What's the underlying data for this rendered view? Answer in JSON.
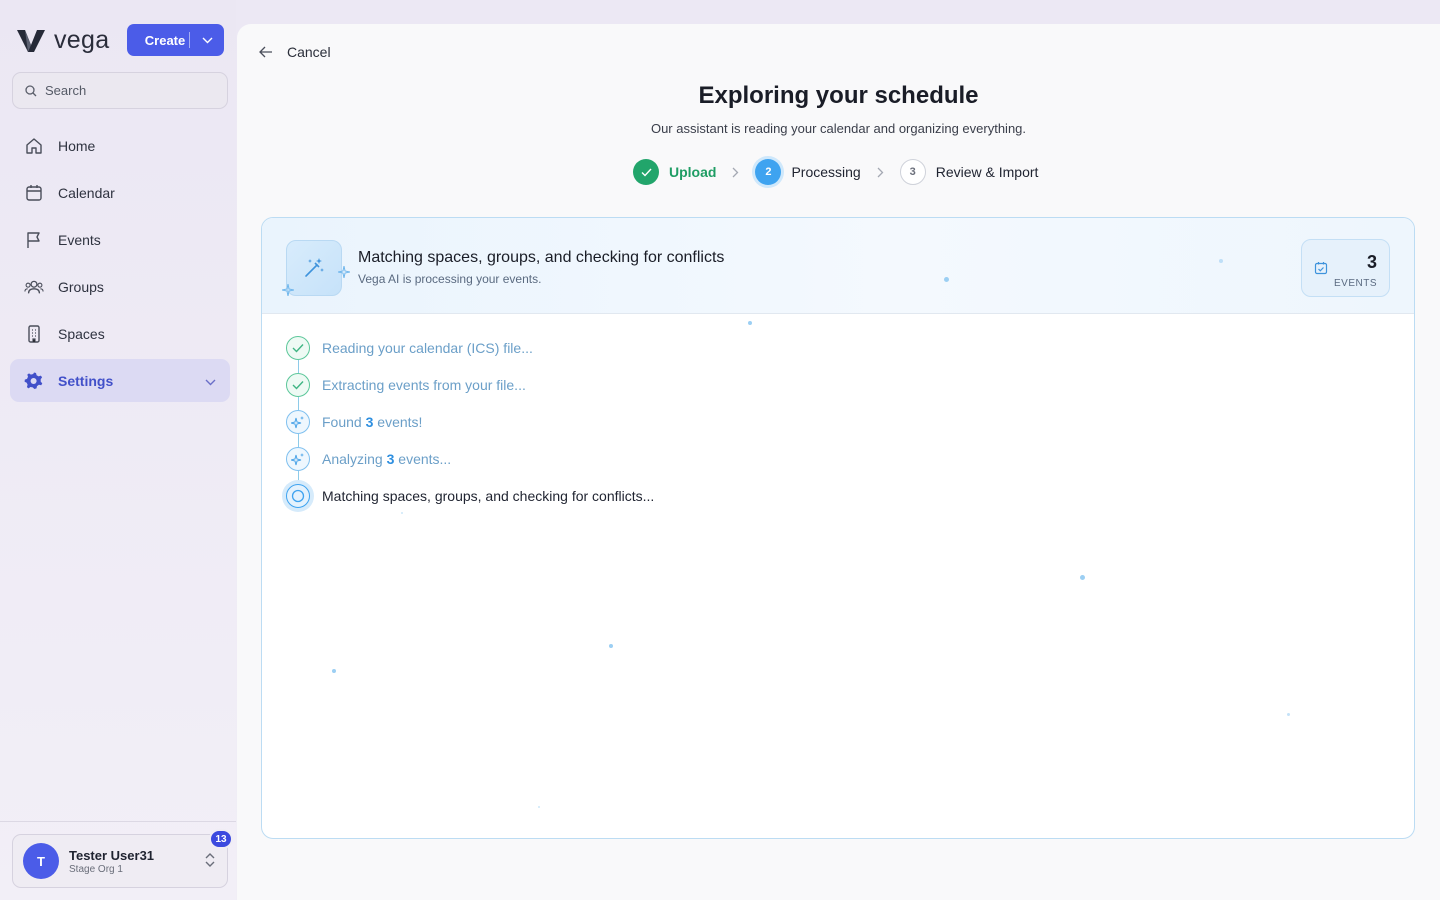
{
  "brand": {
    "name": "vega",
    "create_label": "Create"
  },
  "search": {
    "placeholder": "Search"
  },
  "nav": [
    {
      "label": "Home",
      "icon": "home-icon"
    },
    {
      "label": "Calendar",
      "icon": "calendar-icon"
    },
    {
      "label": "Events",
      "icon": "flag-icon"
    },
    {
      "label": "Groups",
      "icon": "users-icon"
    },
    {
      "label": "Spaces",
      "icon": "building-icon"
    },
    {
      "label": "Settings",
      "icon": "gear-icon",
      "active": true
    }
  ],
  "user": {
    "initial": "T",
    "name": "Tester User31",
    "org": "Stage Org 1",
    "notifications": "13"
  },
  "header": {
    "cancel_label": "Cancel",
    "title": "Exploring your schedule",
    "subtitle": "Our assistant is reading your calendar and organizing everything."
  },
  "stepper": [
    {
      "number": "✓",
      "label": "Upload",
      "state": "done"
    },
    {
      "number": "2",
      "label": "Processing",
      "state": "current"
    },
    {
      "number": "3",
      "label": "Review & Import",
      "state": "todo"
    }
  ],
  "card": {
    "title": "Matching spaces, groups, and checking for conflicts",
    "subtitle": "Vega AI is processing your events.",
    "count": "3",
    "count_label": "EVENTS"
  },
  "progress": {
    "item1": "Reading your calendar (ICS) file...",
    "item2": "Extracting events from your file...",
    "item3_pre": "Found ",
    "item3_num": "3",
    "item3_post": " events!",
    "item4_pre": "Analyzing ",
    "item4_num": "3",
    "item4_post": " events...",
    "item5": "Matching spaces, groups, and checking for conflicts..."
  },
  "colors": {
    "accent": "#4b5ce8",
    "success": "#22a56b",
    "processing": "#3ea3f0"
  }
}
